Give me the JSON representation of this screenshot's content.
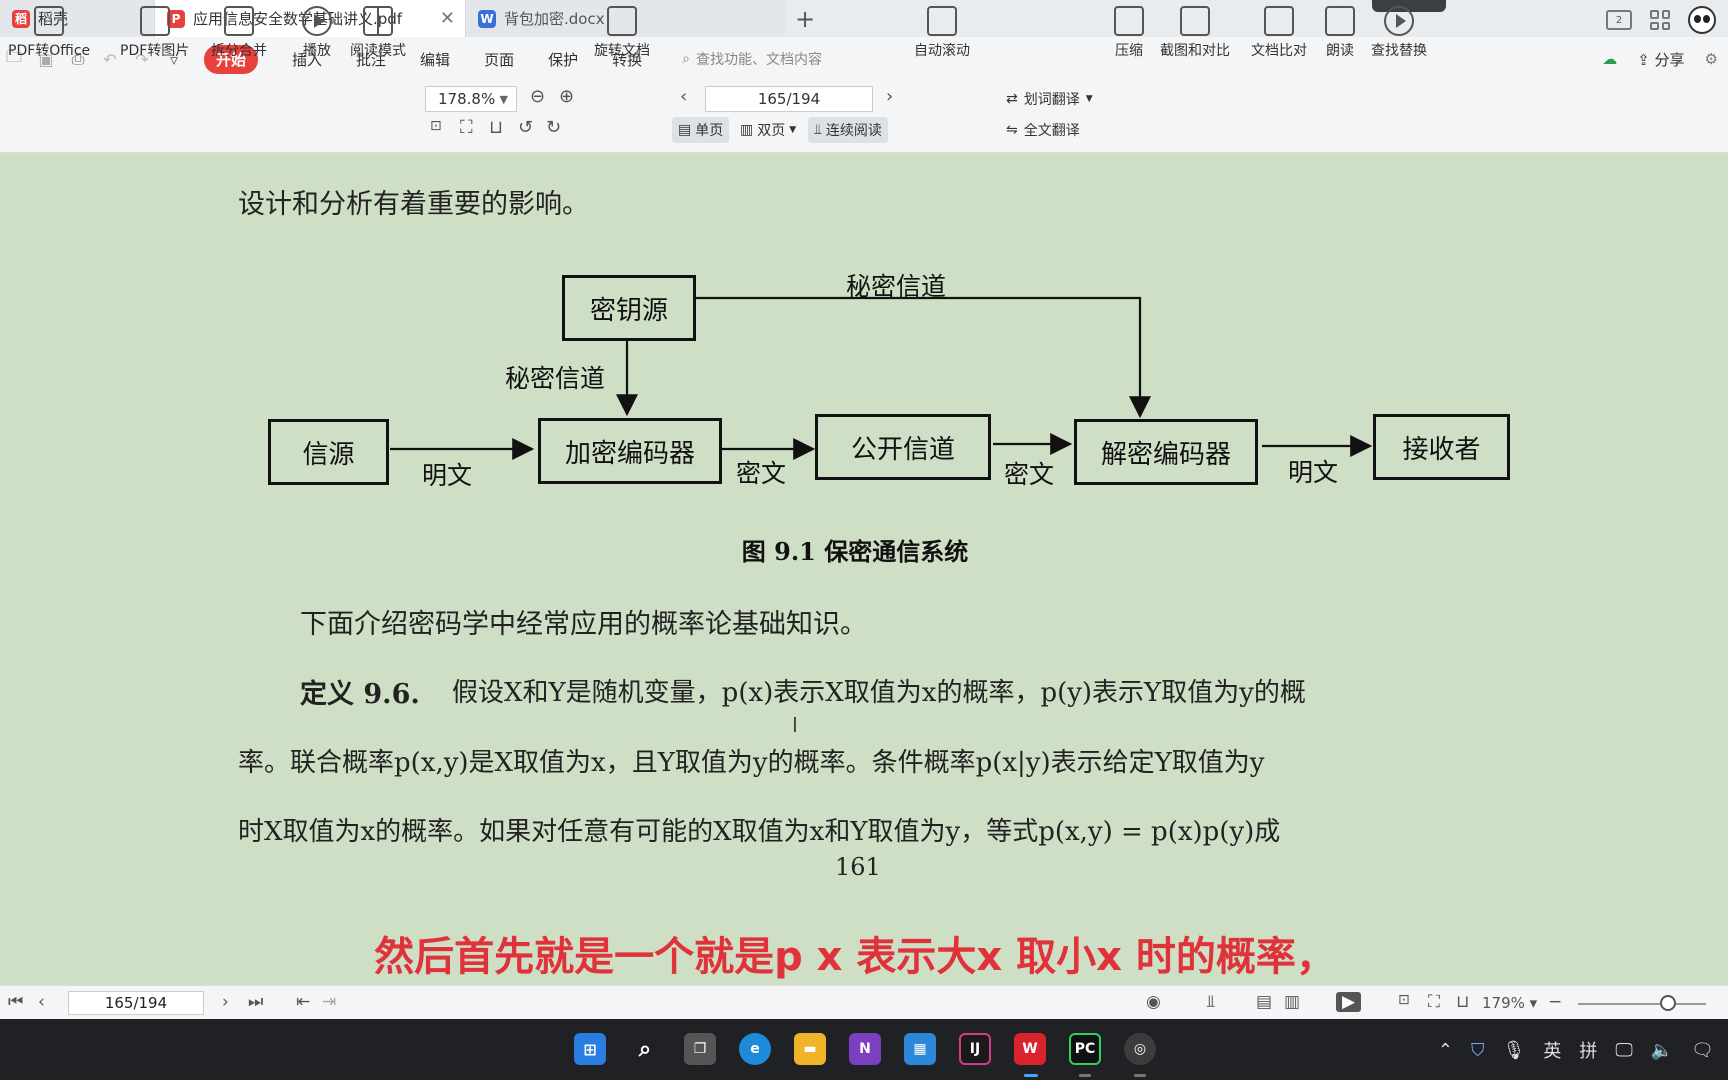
{
  "tabs": [
    {
      "label": "稻壳",
      "icon": "docer-icon",
      "color": "#e8413d"
    },
    {
      "label": "应用信息安全数学基础讲义.pdf",
      "icon": "pdf-icon",
      "color": "#e8413d",
      "close": "✕"
    },
    {
      "label": "背包加密.docx",
      "icon": "word-icon",
      "color": "#3b6fd8"
    }
  ],
  "new_tab": "+",
  "menu": {
    "items": [
      "开始",
      "插入",
      "批注",
      "编辑",
      "页面",
      "保护",
      "转换"
    ],
    "search_placeholder": "查找功能、文档内容",
    "share": "分享"
  },
  "toolbar": {
    "pdf_to_office": "PDF转Office",
    "pdf_to_image": "PDF转图片",
    "split_merge": "拆分合并",
    "play": "播放",
    "read_mode": "阅读模式",
    "zoom": "178.8%",
    "rotate": "旋转文档",
    "page": "165/194",
    "single": "单页",
    "double": "双页",
    "continuous": "连续阅读",
    "auto_scroll": "自动滚动",
    "word_translate": "划词翻译",
    "full_translate": "全文翻译",
    "compress": "压缩",
    "screenshot_compare": "截图和对比",
    "doc_compare": "文档比对",
    "read_aloud": "朗读",
    "find_replace": "查找替换"
  },
  "document": {
    "line_top": "设计和分析有着重要的影响。",
    "diagram": {
      "key_source": "密钥源",
      "secret_channel_top": "秘密信道",
      "secret_channel_left": "秘密信道",
      "source": "信源",
      "encoder": "加密编码器",
      "public_channel": "公开信道",
      "decoder": "解密编码器",
      "receiver": "接收者",
      "plain1": "明文",
      "cipher1": "密文",
      "cipher2": "密文",
      "plain2": "明文"
    },
    "figure_caption": "图 9.1 保密通信系统",
    "para_intro": "下面介绍密码学中经常应用的概率论基础知识。",
    "def_label": "定义  9.6.",
    "def_line1": "假设X和Y是随机变量，p(x)表示X取值为x的概率，p(y)表示Y取值为y的概",
    "def_line2": "率。联合概率p(x,y)是X取值为x，且Y取值为y的概率。条件概率p(x|y)表示给定Y取值为y",
    "def_line3": "时X取值为x的概率。如果对任意有可能的X取值为x和Y取值为y，等式p(x,y) = p(x)p(y)成",
    "page_number": "161"
  },
  "subtitle": "然后首先就是一个就是p x 表示大x 取小x 时的概率，",
  "statusbar": {
    "page": "165/194",
    "zoom": "179%"
  },
  "taskbar": {
    "ime_lang": "英",
    "ime_mode": "拼"
  }
}
